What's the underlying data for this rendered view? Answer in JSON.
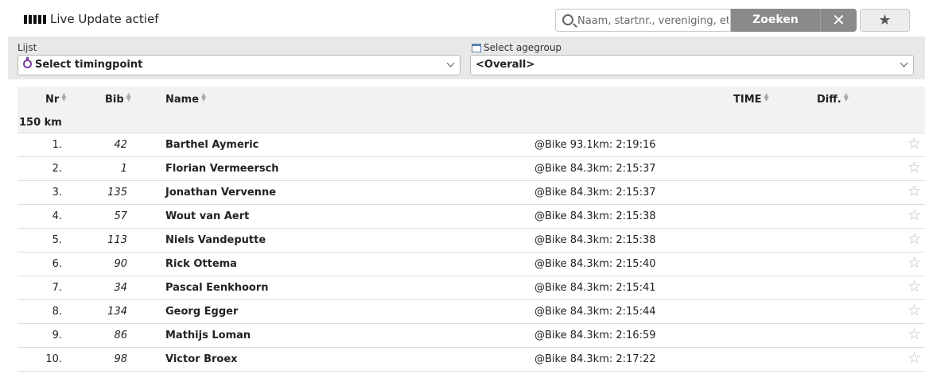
{
  "topbar": {
    "live_label": "Live Update actief",
    "search_placeholder": "Naam, startnr., vereniging, etc.",
    "search_button": "Zoeken",
    "clear_icon": "close-icon",
    "favorites_icon": "star-icon"
  },
  "filters": {
    "list_label": "Lijst",
    "list_value": "Select timingpoint",
    "agegroup_label": "Select agegroup",
    "agegroup_value": "<Overall>"
  },
  "table": {
    "headers": {
      "nr": "Nr",
      "bib": "Bib",
      "name": "Name",
      "time": "TIME",
      "diff": "Diff."
    },
    "group": "150 km",
    "rows": [
      {
        "nr": "1.",
        "bib": "42",
        "name": "Barthel Aymeric",
        "split": "@Bike 93.1km: 2:19:16"
      },
      {
        "nr": "2.",
        "bib": "1",
        "name": "Florian Vermeersch",
        "split": "@Bike 84.3km: 2:15:37"
      },
      {
        "nr": "3.",
        "bib": "135",
        "name": "Jonathan Vervenne",
        "split": "@Bike 84.3km: 2:15:37"
      },
      {
        "nr": "4.",
        "bib": "57",
        "name": "Wout van Aert",
        "split": "@Bike 84.3km: 2:15:38"
      },
      {
        "nr": "5.",
        "bib": "113",
        "name": "Niels Vandeputte",
        "split": "@Bike 84.3km: 2:15:38"
      },
      {
        "nr": "6.",
        "bib": "90",
        "name": "Rick Ottema",
        "split": "@Bike 84.3km: 2:15:40"
      },
      {
        "nr": "7.",
        "bib": "34",
        "name": "Pascal Eenkhoorn",
        "split": "@Bike 84.3km: 2:15:41"
      },
      {
        "nr": "8.",
        "bib": "134",
        "name": "Georg Egger",
        "split": "@Bike 84.3km: 2:15:44"
      },
      {
        "nr": "9.",
        "bib": "86",
        "name": "Mathijs Loman",
        "split": "@Bike 84.3km: 2:16:59"
      },
      {
        "nr": "10.",
        "bib": "98",
        "name": "Victor Broex",
        "split": "@Bike 84.3km: 2:17:22"
      }
    ]
  }
}
